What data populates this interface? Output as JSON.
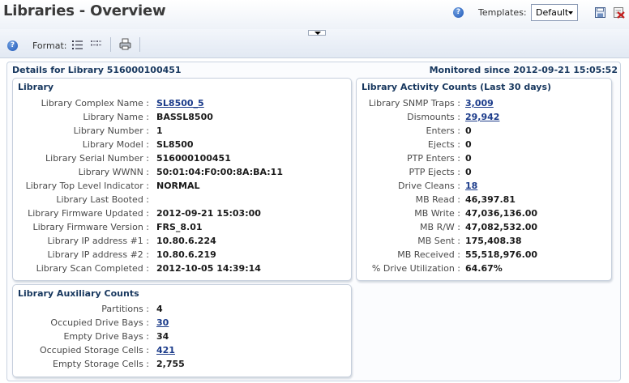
{
  "header": {
    "title": "Libraries - Overview",
    "templates_label": "Templates:",
    "template_selected": "Default"
  },
  "toolbar": {
    "format_label": "Format:"
  },
  "details": {
    "heading": "Details for Library 516000100451",
    "monitored": "Monitored since 2012-09-21 15:05:52"
  },
  "library": {
    "title": "Library",
    "rows": [
      {
        "label": "Library Complex Name :",
        "value": "SL8500_5",
        "link": true
      },
      {
        "label": "Library Name :",
        "value": "BASSL8500",
        "link": false
      },
      {
        "label": "Library Number :",
        "value": "1",
        "link": false
      },
      {
        "label": "Library Model :",
        "value": "SL8500",
        "link": false
      },
      {
        "label": "Library Serial Number :",
        "value": "516000100451",
        "link": false
      },
      {
        "label": "Library WWNN :",
        "value": "50:01:04:F0:00:8A:BA:11",
        "link": false
      },
      {
        "label": "Library Top Level Indicator :",
        "value": "NORMAL",
        "link": false
      },
      {
        "label": "Library Last Booted :",
        "value": "",
        "link": false
      },
      {
        "label": "Library Firmware Updated :",
        "value": "2012-09-21 15:03:00",
        "link": false
      },
      {
        "label": "Library Firmware Version :",
        "value": "FRS_8.01",
        "link": false
      },
      {
        "label": "Library IP address #1 :",
        "value": "10.80.6.224",
        "link": false
      },
      {
        "label": "Library IP address #2 :",
        "value": "10.80.6.219",
        "link": false
      },
      {
        "label": "Library Scan Completed :",
        "value": "2012-10-05 14:39:14",
        "link": false
      }
    ]
  },
  "activity": {
    "title": "Library Activity Counts (Last 30 days)",
    "rows": [
      {
        "label": "Library SNMP Traps :",
        "value": "3,009",
        "link": true
      },
      {
        "label": "Dismounts :",
        "value": "29,942",
        "link": true
      },
      {
        "label": "Enters :",
        "value": "0",
        "link": false
      },
      {
        "label": "Ejects :",
        "value": "0",
        "link": false
      },
      {
        "label": "PTP Enters :",
        "value": "0",
        "link": false
      },
      {
        "label": "PTP Ejects :",
        "value": "0",
        "link": false
      },
      {
        "label": "Drive Cleans :",
        "value": "18",
        "link": true
      },
      {
        "label": "MB Read :",
        "value": "46,397.81",
        "link": false
      },
      {
        "label": "MB Write :",
        "value": "47,036,136.00",
        "link": false
      },
      {
        "label": "MB R/W :",
        "value": "47,082,532.00",
        "link": false
      },
      {
        "label": "MB Sent :",
        "value": "175,408.38",
        "link": false
      },
      {
        "label": "MB Received :",
        "value": "55,518,976.00",
        "link": false
      },
      {
        "label": "% Drive Utilization :",
        "value": "64.67%",
        "link": false
      }
    ]
  },
  "auxiliary": {
    "title": "Library Auxiliary Counts",
    "rows": [
      {
        "label": "Partitions :",
        "value": "4",
        "link": false
      },
      {
        "label": "Occupied Drive Bays :",
        "value": "30",
        "link": true
      },
      {
        "label": "Empty Drive Bays :",
        "value": "34",
        "link": false
      },
      {
        "label": "Occupied Storage Cells :",
        "value": "421",
        "link": true
      },
      {
        "label": "Empty Storage Cells :",
        "value": "2,755",
        "link": false
      }
    ]
  },
  "icons": [
    "help-icon",
    "list-view-icon",
    "grid-view-icon",
    "print-icon",
    "save-template-icon",
    "delete-template-icon",
    "collapse-icon"
  ]
}
